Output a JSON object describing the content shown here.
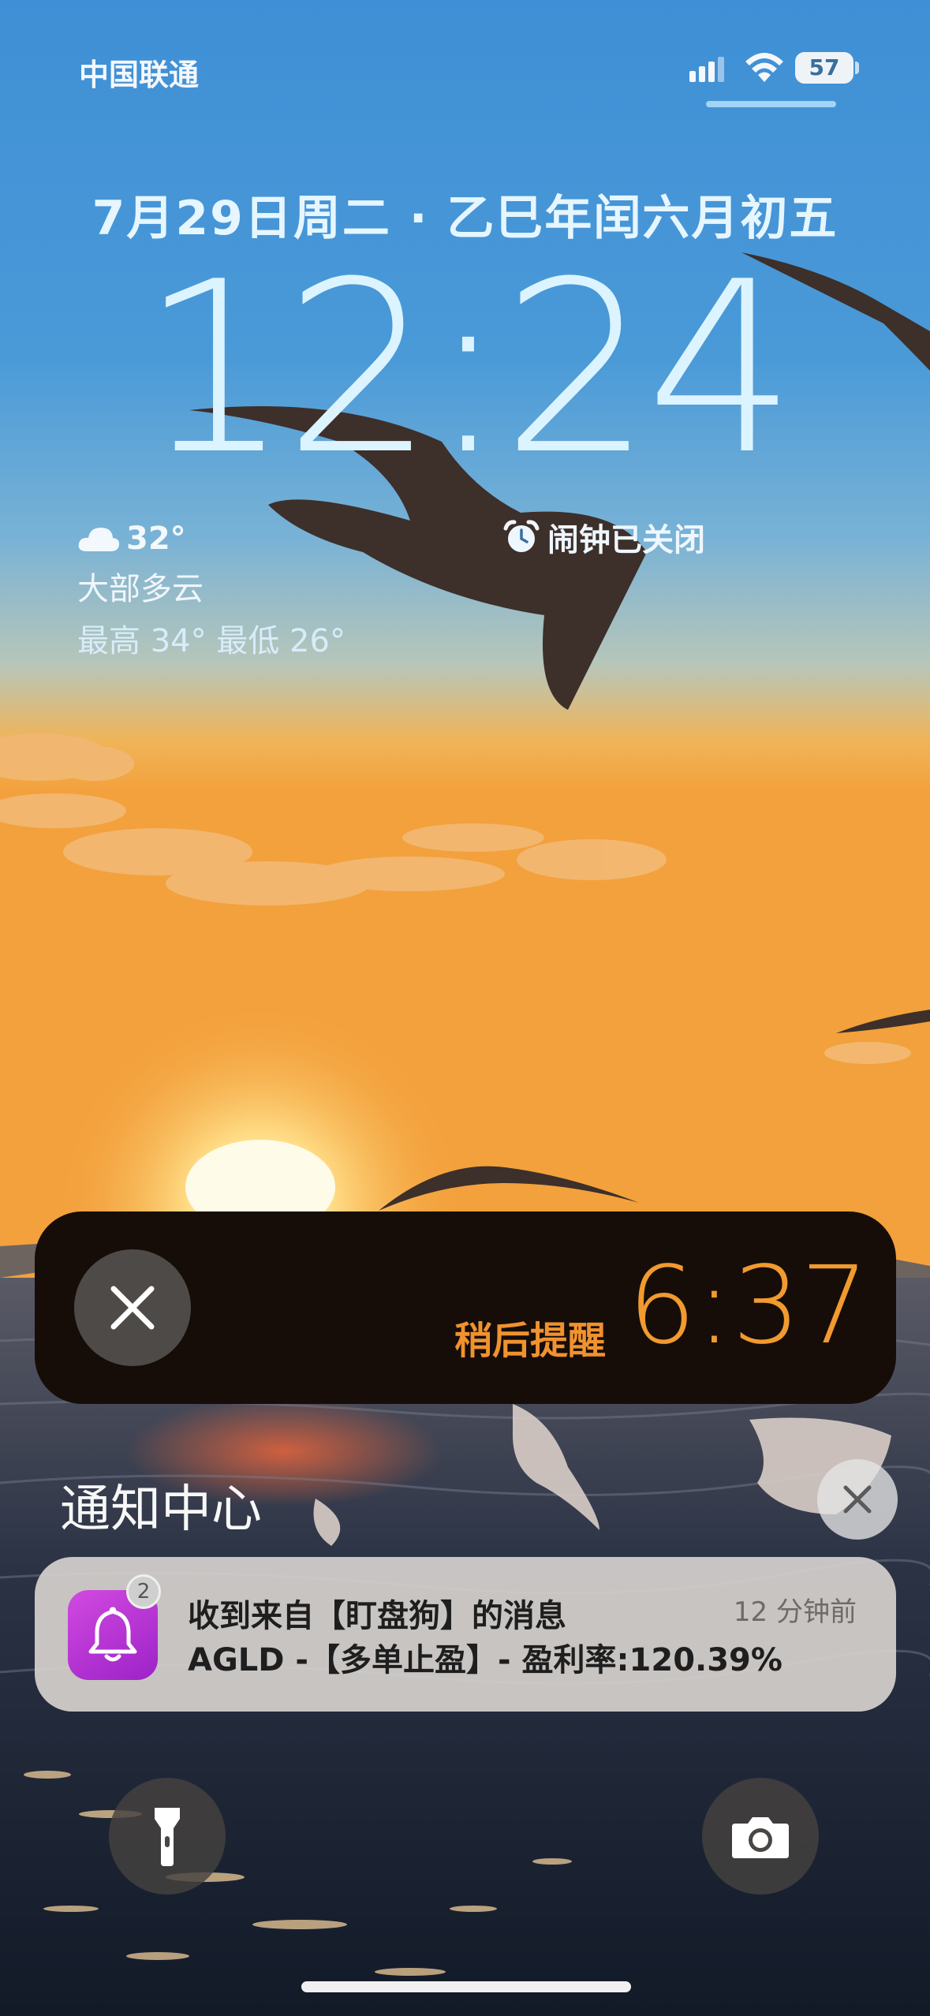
{
  "status_bar": {
    "carrier": "中国联通",
    "battery": "57",
    "icons": [
      "signal-icon",
      "wifi-icon",
      "battery-icon"
    ]
  },
  "lock": {
    "date": "7月29日周二 · 乙巳年闰六月初五",
    "time": "12:24"
  },
  "weather": {
    "icon": "cloud-icon",
    "temperature": "32°",
    "condition": "大部多云",
    "high_low": "最高 34° 最低 26°"
  },
  "alarm_widget": {
    "icon": "alarm-clock-icon",
    "label": "闹钟已关闭"
  },
  "snooze_banner": {
    "label": "稍后提醒",
    "time": "6:37",
    "accent": "#F19A2F"
  },
  "notification_center": {
    "title": "通知中心",
    "notifications": [
      {
        "app_icon": "bell-icon",
        "badge": "2",
        "title": "收到来自【盯盘狗】的消息",
        "time": "12 分钟前",
        "body": "AGLD -【多单止盈】- 盈利率:120.39%",
        "icon_color": "#C43ADA"
      }
    ]
  },
  "quick_actions": {
    "left": "flashlight-icon",
    "right": "camera-icon"
  }
}
